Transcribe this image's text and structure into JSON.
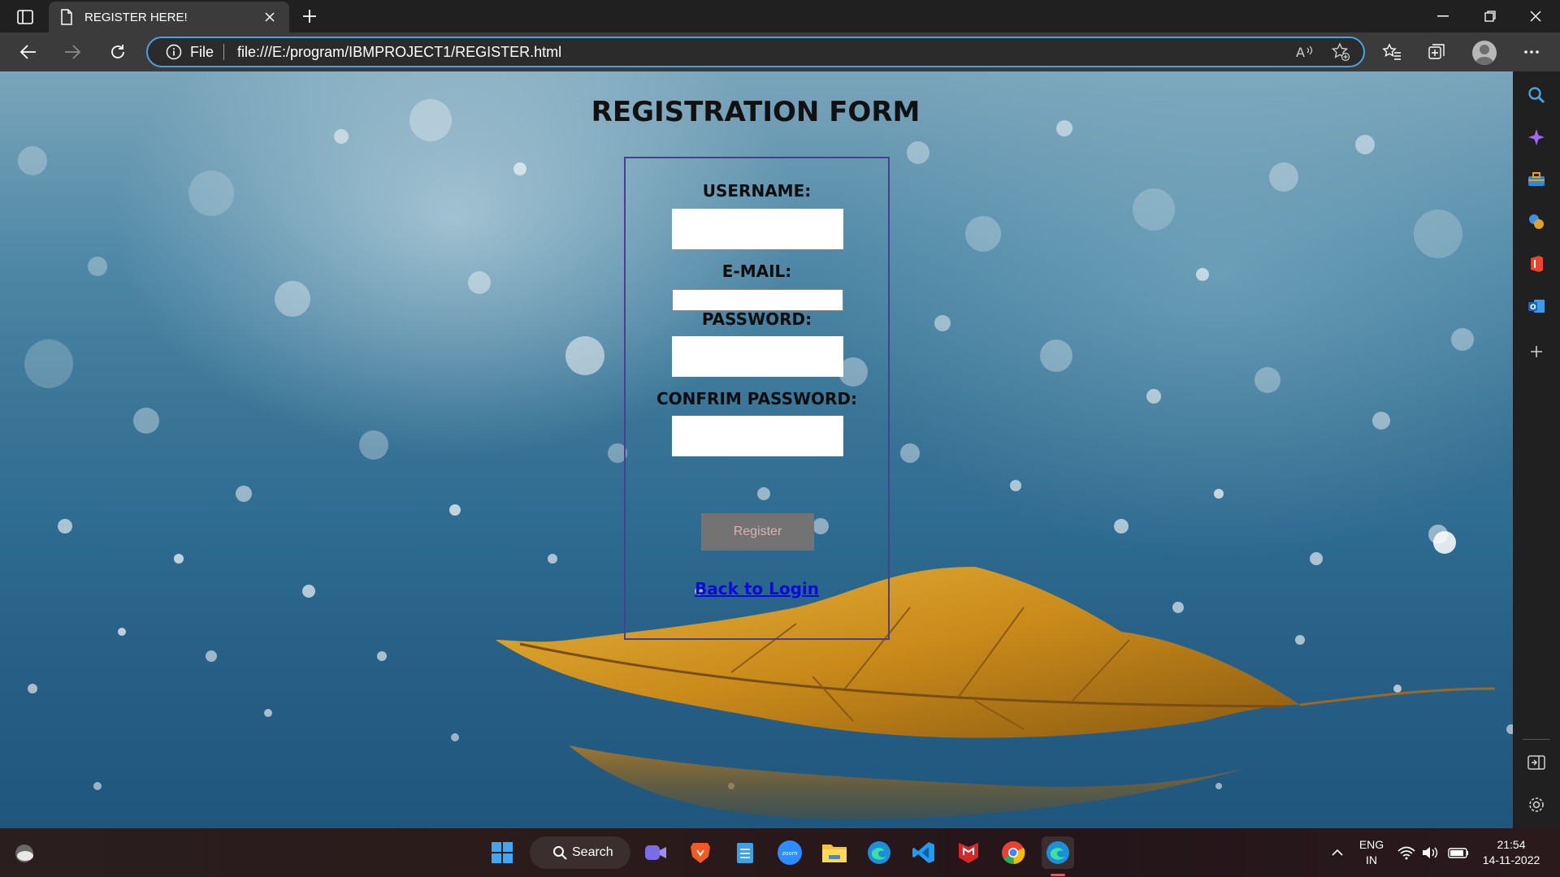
{
  "browser": {
    "tab_title": "REGISTER HERE!",
    "address": {
      "scheme": "File",
      "url": "file:///E:/program/IBMPROJECT1/REGISTER.html"
    }
  },
  "page": {
    "title": "REGISTRATION FORM",
    "form": {
      "username_label": "USERNAME:",
      "username_value": "",
      "email_label": "E-MAIL:",
      "email_value": "",
      "password_label": "PASSWORD:",
      "password_value": "",
      "confirm_label": "CONFRIM PASSWORD:",
      "confirm_value": "",
      "register_button": "Register",
      "back_link": "Back to Login"
    }
  },
  "taskbar": {
    "search_label": "Search",
    "apps": [
      "weather",
      "meet",
      "brave",
      "notepad",
      "zoom",
      "file-explorer",
      "edge",
      "vscode",
      "mcafee",
      "chrome",
      "edge-active"
    ],
    "zoom_label": "zoom",
    "language": "ENG",
    "region": "IN",
    "time": "21:54",
    "date": "14-11-2022"
  },
  "colors": {
    "accent": "#4aa3e0",
    "form_border": "#4a3e8f",
    "link": "#0a0ae0",
    "button_bg": "#737373"
  }
}
